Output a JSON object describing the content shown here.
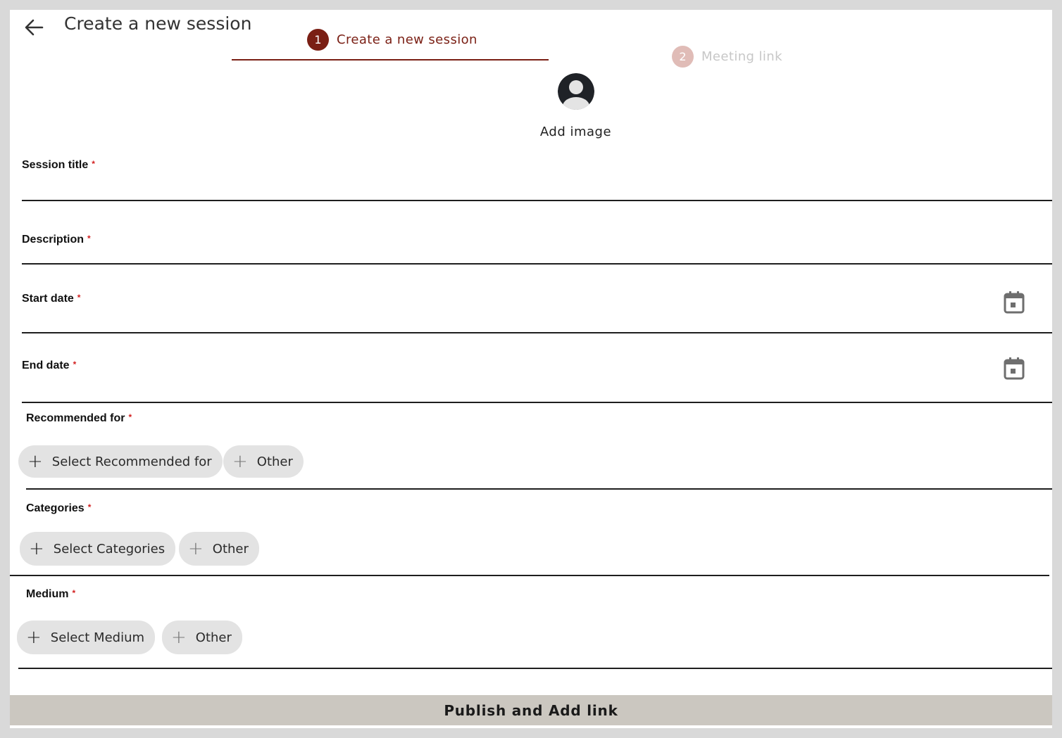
{
  "header": {
    "title": "Create a new session"
  },
  "stepper": {
    "steps": [
      {
        "number": "1",
        "label": "Create a new session",
        "active": true
      },
      {
        "number": "2",
        "label": "Meeting link",
        "active": false
      }
    ],
    "active_color": "#7a1f14",
    "inactive_color": "#e0bcb7",
    "inactive_text_color": "#c7c7c7"
  },
  "avatar": {
    "label": "Add image"
  },
  "fields": {
    "session_title": {
      "label": "Session title",
      "required": "*",
      "value": ""
    },
    "description": {
      "label": "Description",
      "required": "*",
      "value": ""
    },
    "start_date": {
      "label": "Start date",
      "required": "*",
      "value": ""
    },
    "end_date": {
      "label": "End date",
      "required": "*",
      "value": ""
    }
  },
  "recommended_for": {
    "label": "Recommended for",
    "required": "*",
    "select_label": "Select Recommended for",
    "other_label": "Other"
  },
  "categories": {
    "label": "Categories",
    "required": "*",
    "select_label": "Select Categories",
    "other_label": "Other"
  },
  "medium": {
    "label": "Medium",
    "required": "*",
    "select_label": "Select Medium",
    "other_label": "Other"
  },
  "footer": {
    "publish_label": "Publish and Add link"
  },
  "icons": {
    "back": "arrow-left-icon",
    "calendar": "calendar-icon",
    "plus": "plus-icon",
    "avatar": "user-avatar-icon"
  },
  "colors": {
    "accent": "#7a1f14",
    "required": "#d21f1f",
    "chip_bg": "#e3e3e3",
    "publish_bg": "#cbc7c0",
    "calendar": "#6e6e6e"
  }
}
